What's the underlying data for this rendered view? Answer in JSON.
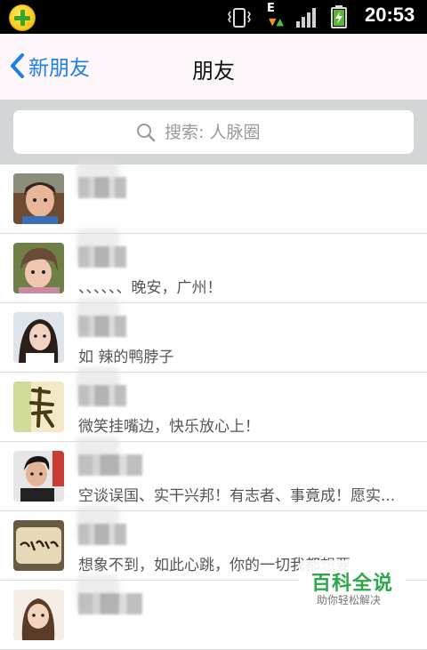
{
  "status_bar": {
    "time": "20:53",
    "icons": [
      "qq-app-icon",
      "vibrate-icon",
      "data-e-icon",
      "signal-icon",
      "battery-charging-icon"
    ],
    "data_type": "E"
  },
  "header": {
    "back_label": "新朋友",
    "title": "朋友"
  },
  "search": {
    "placeholder": "搜索: 人脉圈"
  },
  "friends": [
    {
      "status": ""
    },
    {
      "status": "、、、、、、晚安，广州！"
    },
    {
      "status": "如  辣的鸭脖子"
    },
    {
      "status": "微笑挂嘴边，快乐放心上！"
    },
    {
      "status": "空谈误国、实干兴邦！有志者、事竟成！愿实..."
    },
    {
      "status": "想象不到，如此心跳，你的一切我都想要"
    },
    {
      "status": ""
    }
  ],
  "watermark": {
    "main": "百科全说",
    "sub": "助你轻松解决"
  },
  "colors": {
    "accent": "#1d7fe0",
    "title_bar": "#fdf6fb",
    "search_bg": "#d3d6d6",
    "watermark_green": "#2aa84a"
  }
}
